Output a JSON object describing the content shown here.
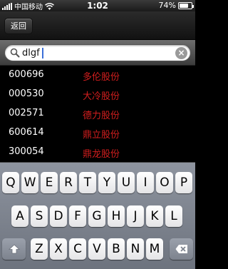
{
  "status_bar": {
    "carrier": "中国移动",
    "time": "1:02",
    "battery_text": "74%",
    "battery_level": 0.74,
    "icons": [
      "signal-icon",
      "wifi-icon",
      "battery-icon"
    ]
  },
  "nav": {
    "back_label": "返回"
  },
  "search": {
    "value": "dlgf",
    "icons": [
      "search-icon",
      "clear-icon"
    ]
  },
  "results": [
    {
      "code": "600696",
      "name": "多伦股份"
    },
    {
      "code": "000530",
      "name": "大冷股份"
    },
    {
      "code": "002571",
      "name": "德力股份"
    },
    {
      "code": "600614",
      "name": "鼎立股份"
    },
    {
      "code": "300054",
      "name": "鼎龙股份"
    }
  ],
  "keyboard": {
    "row1": [
      "Q",
      "W",
      "E",
      "R",
      "T",
      "Y",
      "U",
      "I",
      "O",
      "P"
    ],
    "row2": [
      "A",
      "S",
      "D",
      "F",
      "G",
      "H",
      "J",
      "K",
      "L"
    ],
    "row3": [
      "Z",
      "X",
      "C",
      "V",
      "B",
      "N",
      "M"
    ],
    "special_icons": [
      "shift-icon",
      "delete-icon"
    ]
  },
  "colors": {
    "result_name": "#d41e1e",
    "result_code": "#ffffff"
  }
}
